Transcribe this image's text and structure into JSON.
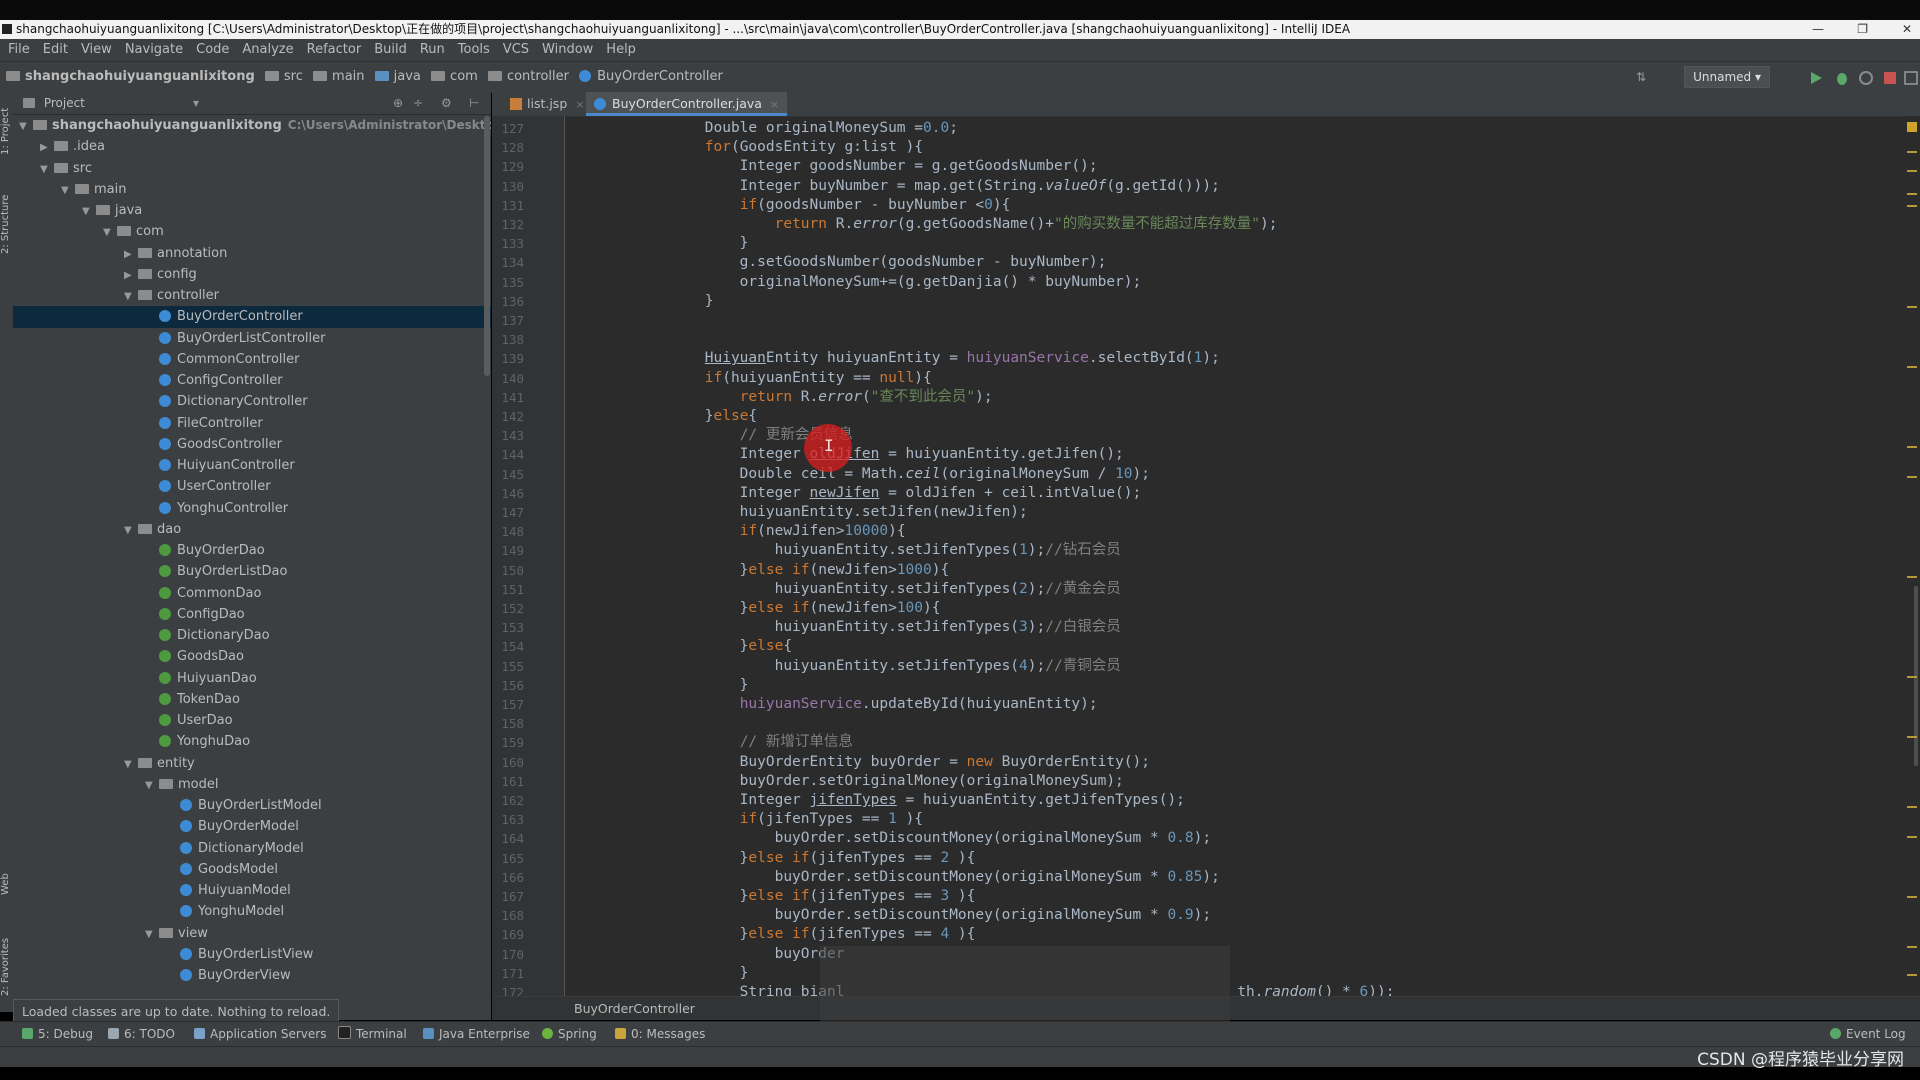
{
  "window": {
    "title": "shangchaohuiyuanguanlixitong [C:\\Users\\Administrator\\Desktop\\正在做的项目\\project\\shangchaohuiyuanguanlixitong] - ...\\src\\main\\java\\com\\controller\\BuyOrderController.java [shangchaohuiyuanguanlixitong] - IntelliJ IDEA"
  },
  "menu": [
    "File",
    "Edit",
    "View",
    "Navigate",
    "Code",
    "Analyze",
    "Refactor",
    "Build",
    "Run",
    "Tools",
    "VCS",
    "Window",
    "Help"
  ],
  "navbar": {
    "crumbs": [
      "shangchaohuiyuanguanlixitong",
      "src",
      "main",
      "java",
      "com",
      "controller",
      "BuyOrderController"
    ],
    "run_config": "Unnamed"
  },
  "left_strip": {
    "project": "1: Project",
    "structure": "2: Structure",
    "web": "Web",
    "favorites": "2: Favorites"
  },
  "project_panel": {
    "title": "Project",
    "tree": [
      {
        "label": "shangchaohuiyuanguanlixitong",
        "path": "C:\\Users\\Administrator\\Desktop\\正在做",
        "depth": 0,
        "arrow": "▼",
        "icon": "folder",
        "bold": true
      },
      {
        "label": ".idea",
        "depth": 1,
        "arrow": "▶",
        "icon": "folder"
      },
      {
        "label": "src",
        "depth": 1,
        "arrow": "▼",
        "icon": "folder"
      },
      {
        "label": "main",
        "depth": 2,
        "arrow": "▼",
        "icon": "folder"
      },
      {
        "label": "java",
        "depth": 3,
        "arrow": "▼",
        "icon": "folder"
      },
      {
        "label": "com",
        "depth": 4,
        "arrow": "▼",
        "icon": "folder"
      },
      {
        "label": "annotation",
        "depth": 5,
        "arrow": "▶",
        "icon": "folder"
      },
      {
        "label": "config",
        "depth": 5,
        "arrow": "▶",
        "icon": "folder"
      },
      {
        "label": "controller",
        "depth": 5,
        "arrow": "▼",
        "icon": "folder"
      },
      {
        "label": "BuyOrderController",
        "depth": 6,
        "icon": "class",
        "selected": true
      },
      {
        "label": "BuyOrderListController",
        "depth": 6,
        "icon": "class"
      },
      {
        "label": "CommonController",
        "depth": 6,
        "icon": "class"
      },
      {
        "label": "ConfigController",
        "depth": 6,
        "icon": "class"
      },
      {
        "label": "DictionaryController",
        "depth": 6,
        "icon": "class"
      },
      {
        "label": "FileController",
        "depth": 6,
        "icon": "class"
      },
      {
        "label": "GoodsController",
        "depth": 6,
        "icon": "class"
      },
      {
        "label": "HuiyuanController",
        "depth": 6,
        "icon": "class"
      },
      {
        "label": "UserController",
        "depth": 6,
        "icon": "class"
      },
      {
        "label": "YonghuController",
        "depth": 6,
        "icon": "class"
      },
      {
        "label": "dao",
        "depth": 5,
        "arrow": "▼",
        "icon": "folder"
      },
      {
        "label": "BuyOrderDao",
        "depth": 6,
        "icon": "interface"
      },
      {
        "label": "BuyOrderListDao",
        "depth": 6,
        "icon": "interface"
      },
      {
        "label": "CommonDao",
        "depth": 6,
        "icon": "interface"
      },
      {
        "label": "ConfigDao",
        "depth": 6,
        "icon": "interface"
      },
      {
        "label": "DictionaryDao",
        "depth": 6,
        "icon": "interface"
      },
      {
        "label": "GoodsDao",
        "depth": 6,
        "icon": "interface"
      },
      {
        "label": "HuiyuanDao",
        "depth": 6,
        "icon": "interface"
      },
      {
        "label": "TokenDao",
        "depth": 6,
        "icon": "interface"
      },
      {
        "label": "UserDao",
        "depth": 6,
        "icon": "interface"
      },
      {
        "label": "YonghuDao",
        "depth": 6,
        "icon": "interface"
      },
      {
        "label": "entity",
        "depth": 5,
        "arrow": "▼",
        "icon": "folder"
      },
      {
        "label": "model",
        "depth": 6,
        "arrow": "▼",
        "icon": "folder"
      },
      {
        "label": "BuyOrderListModel",
        "depth": 7,
        "icon": "class"
      },
      {
        "label": "BuyOrderModel",
        "depth": 7,
        "icon": "class"
      },
      {
        "label": "DictionaryModel",
        "depth": 7,
        "icon": "class"
      },
      {
        "label": "GoodsModel",
        "depth": 7,
        "icon": "class"
      },
      {
        "label": "HuiyuanModel",
        "depth": 7,
        "icon": "class"
      },
      {
        "label": "YonghuModel",
        "depth": 7,
        "icon": "class"
      },
      {
        "label": "view",
        "depth": 6,
        "arrow": "▼",
        "icon": "folder"
      },
      {
        "label": "BuyOrderListView",
        "depth": 7,
        "icon": "class"
      },
      {
        "label": "BuyOrderView",
        "depth": 7,
        "icon": "class"
      }
    ],
    "toast": "Loaded classes are up to date. Nothing to reload."
  },
  "tabs": [
    {
      "label": "list.jsp",
      "active": false
    },
    {
      "label": "BuyOrderController.java",
      "active": true
    }
  ],
  "code": {
    "first_line": 127,
    "lines": [
      [
        [
          "            Double originalMoneySum =",
          ""
        ],
        [
          "0.0",
          "num"
        ],
        [
          ";",
          ""
        ]
      ],
      [
        [
          "            ",
          ""
        ],
        [
          "for",
          "kw"
        ],
        [
          "(GoodsEntity g:list ){",
          ""
        ]
      ],
      [
        [
          "                Integer goodsNumber = g.getGoodsNumber();",
          ""
        ]
      ],
      [
        [
          "                Integer buyNumber = map.get(String.",
          ""
        ],
        [
          "valueOf",
          "ital"
        ],
        [
          "(g.getId()));",
          ""
        ]
      ],
      [
        [
          "                ",
          ""
        ],
        [
          "if",
          "kw"
        ],
        [
          "(goodsNumber - buyNumber <",
          ""
        ],
        [
          "0",
          "num"
        ],
        [
          "){",
          ""
        ]
      ],
      [
        [
          "                    ",
          ""
        ],
        [
          "return",
          "kw"
        ],
        [
          " R.",
          ""
        ],
        [
          "error",
          "ital"
        ],
        [
          "(g.getGoodsName()+",
          ""
        ],
        [
          "\"的购买数量不能超过库存数量\"",
          "str"
        ],
        [
          ");",
          ""
        ]
      ],
      [
        [
          "                }",
          ""
        ]
      ],
      [
        [
          "                g.setGoodsNumber(goodsNumber - buyNumber);",
          ""
        ]
      ],
      [
        [
          "                originalMoneySum+=(g.getDanjia() * buyNumber);",
          ""
        ]
      ],
      [
        [
          "            }",
          ""
        ]
      ],
      [
        [
          "",
          ""
        ]
      ],
      [
        [
          "",
          ""
        ]
      ],
      [
        [
          "            ",
          ""
        ],
        [
          "Huiyuan",
          "ul"
        ],
        [
          "Entity huiyuanEntity = ",
          ""
        ],
        [
          "huiyuanService",
          "fld"
        ],
        [
          ".selectById(",
          ""
        ],
        [
          "1",
          "num"
        ],
        [
          ");",
          ""
        ]
      ],
      [
        [
          "            ",
          ""
        ],
        [
          "if",
          "kw"
        ],
        [
          "(huiyuanEntity == ",
          ""
        ],
        [
          "null",
          "kw"
        ],
        [
          "){",
          ""
        ]
      ],
      [
        [
          "                ",
          ""
        ],
        [
          "return",
          "kw"
        ],
        [
          " R.",
          ""
        ],
        [
          "error",
          "ital"
        ],
        [
          "(",
          ""
        ],
        [
          "\"查不到此会员\"",
          "str"
        ],
        [
          ");",
          ""
        ]
      ],
      [
        [
          "            }",
          ""
        ],
        [
          "else",
          "kw"
        ],
        [
          "{",
          ""
        ]
      ],
      [
        [
          "                ",
          ""
        ],
        [
          "// 更新会员信息",
          "cmt"
        ]
      ],
      [
        [
          "                Integer ",
          ""
        ],
        [
          "oldJifen",
          "ul"
        ],
        [
          " = huiyuanEntity.getJifen();",
          ""
        ]
      ],
      [
        [
          "                Double ceil = Math.",
          ""
        ],
        [
          "ceil",
          "ital"
        ],
        [
          "(originalMoneySum / ",
          ""
        ],
        [
          "10",
          "num"
        ],
        [
          ");",
          ""
        ]
      ],
      [
        [
          "                Integer ",
          ""
        ],
        [
          "newJifen",
          "ul"
        ],
        [
          " = oldJifen + ceil.intValue();",
          ""
        ]
      ],
      [
        [
          "                huiyuanEntity.setJifen(newJifen);",
          ""
        ]
      ],
      [
        [
          "                ",
          ""
        ],
        [
          "if",
          "kw"
        ],
        [
          "(newJifen>",
          ""
        ],
        [
          "10000",
          "num"
        ],
        [
          "){",
          ""
        ]
      ],
      [
        [
          "                    huiyuanEntity.setJifenTypes(",
          ""
        ],
        [
          "1",
          "num"
        ],
        [
          ");",
          ""
        ],
        [
          "//钻石会员",
          "cmt"
        ]
      ],
      [
        [
          "                }",
          ""
        ],
        [
          "else if",
          "kw"
        ],
        [
          "(newJifen>",
          ""
        ],
        [
          "1000",
          "num"
        ],
        [
          "){",
          ""
        ]
      ],
      [
        [
          "                    huiyuanEntity.setJifenTypes(",
          ""
        ],
        [
          "2",
          "num"
        ],
        [
          ");",
          ""
        ],
        [
          "//黄金会员",
          "cmt"
        ]
      ],
      [
        [
          "                }",
          ""
        ],
        [
          "else if",
          "kw"
        ],
        [
          "(newJifen>",
          ""
        ],
        [
          "100",
          "num"
        ],
        [
          "){",
          ""
        ]
      ],
      [
        [
          "                    huiyuanEntity.setJifenTypes(",
          ""
        ],
        [
          "3",
          "num"
        ],
        [
          ");",
          ""
        ],
        [
          "//白银会员",
          "cmt"
        ]
      ],
      [
        [
          "                }",
          ""
        ],
        [
          "else",
          "kw"
        ],
        [
          "{",
          ""
        ]
      ],
      [
        [
          "                    huiyuanEntity.setJifenTypes(",
          ""
        ],
        [
          "4",
          "num"
        ],
        [
          ");",
          ""
        ],
        [
          "//青铜会员",
          "cmt"
        ]
      ],
      [
        [
          "                }",
          ""
        ]
      ],
      [
        [
          "                ",
          ""
        ],
        [
          "huiyuanService",
          "fld"
        ],
        [
          ".updateById(huiyuanEntity);",
          ""
        ]
      ],
      [
        [
          "",
          ""
        ]
      ],
      [
        [
          "                ",
          ""
        ],
        [
          "// 新增订单信息",
          "cmt"
        ]
      ],
      [
        [
          "                BuyOrderEntity buyOrder = ",
          ""
        ],
        [
          "new",
          "kw"
        ],
        [
          " BuyOrderEntity();",
          ""
        ]
      ],
      [
        [
          "                buyOrder.setOriginalMoney(originalMoneySum);",
          ""
        ]
      ],
      [
        [
          "                Integer ",
          ""
        ],
        [
          "jifenTypes",
          "ul"
        ],
        [
          " = huiyuanEntity.getJifenTypes();",
          ""
        ]
      ],
      [
        [
          "                ",
          ""
        ],
        [
          "if",
          "kw"
        ],
        [
          "(jifenTypes == ",
          ""
        ],
        [
          "1",
          "num"
        ],
        [
          " ){",
          ""
        ]
      ],
      [
        [
          "                    buyOrder.setDiscountMoney(originalMoneySum * ",
          ""
        ],
        [
          "0.8",
          "num"
        ],
        [
          ");",
          ""
        ]
      ],
      [
        [
          "                }",
          ""
        ],
        [
          "else if",
          "kw"
        ],
        [
          "(jifenTypes == ",
          ""
        ],
        [
          "2",
          "num"
        ],
        [
          " ){",
          ""
        ]
      ],
      [
        [
          "                    buyOrder.setDiscountMoney(originalMoneySum * ",
          ""
        ],
        [
          "0.85",
          "num"
        ],
        [
          ");",
          ""
        ]
      ],
      [
        [
          "                }",
          ""
        ],
        [
          "else if",
          "kw"
        ],
        [
          "(jifenTypes == ",
          ""
        ],
        [
          "3",
          "num"
        ],
        [
          " ){",
          ""
        ]
      ],
      [
        [
          "                    buyOrder.setDiscountMoney(originalMoneySum * ",
          ""
        ],
        [
          "0.9",
          "num"
        ],
        [
          ");",
          ""
        ]
      ],
      [
        [
          "                }",
          ""
        ],
        [
          "else if",
          "kw"
        ],
        [
          "(jifenTypes == ",
          ""
        ],
        [
          "4",
          "num"
        ],
        [
          " ){",
          ""
        ]
      ],
      [
        [
          "                    buyOrder",
          ""
        ]
      ],
      [
        [
          "                }",
          ""
        ]
      ],
      [
        [
          "                String bianl",
          ""
        ],
        [
          "                                             th.",
          ""
        ],
        [
          "random",
          "ital"
        ],
        [
          "() * ",
          ""
        ],
        [
          "6",
          "num"
        ],
        [
          "));",
          ""
        ]
      ]
    ]
  },
  "editor_breadcrumb": "BuyOrderController",
  "bottom_tools": [
    "5: Debug",
    "6: TODO",
    "Application Servers",
    "Terminal",
    "Java Enterprise",
    "Spring",
    "0: Messages"
  ],
  "event_log": "Event Log",
  "watermark": "CSDN @程序猿毕业分享网"
}
